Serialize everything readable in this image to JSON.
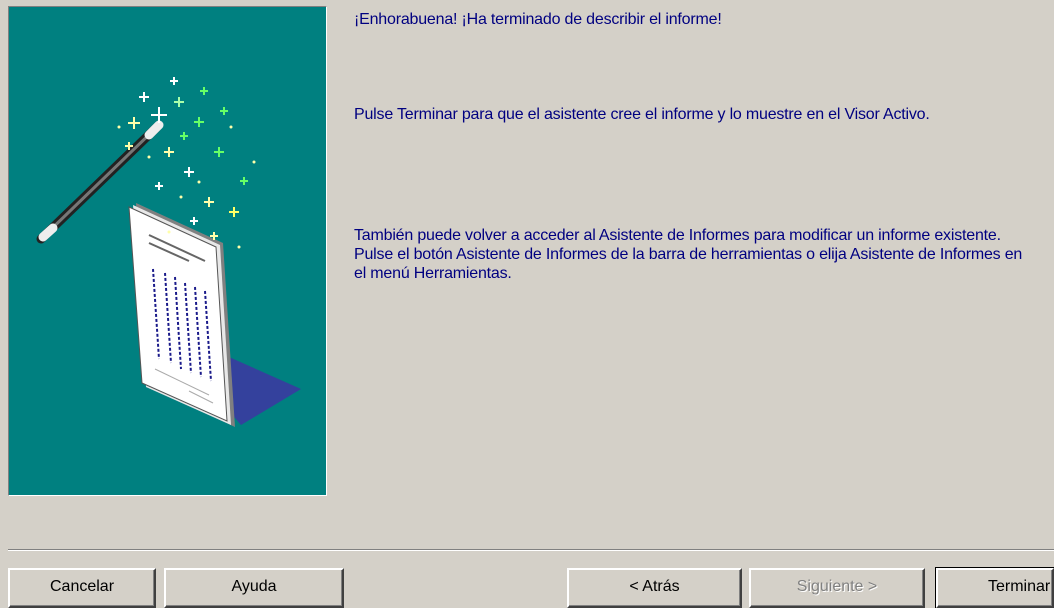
{
  "wizard": {
    "heading": "¡Enhorabuena! ¡Ha terminado de describir el informe!",
    "paragraph_finish": "Pulse Terminar para que el asistente cree el informe y lo muestre en el Visor Activo.",
    "paragraph_reaccess": "También puede volver a acceder al Asistente de Informes para modificar un informe existente. Pulse el botón Asistente de Informes de la barra de herramientas o elija Asistente de Informes en el menú Herramientas."
  },
  "buttons": {
    "cancel": "Cancelar",
    "help": "Ayuda",
    "back": "< Atrás",
    "next": "Siguiente >",
    "finish": "Terminar"
  },
  "colors": {
    "panel_background": "#008080",
    "text": "#000080",
    "dialog_face": "#d4d0c8"
  }
}
